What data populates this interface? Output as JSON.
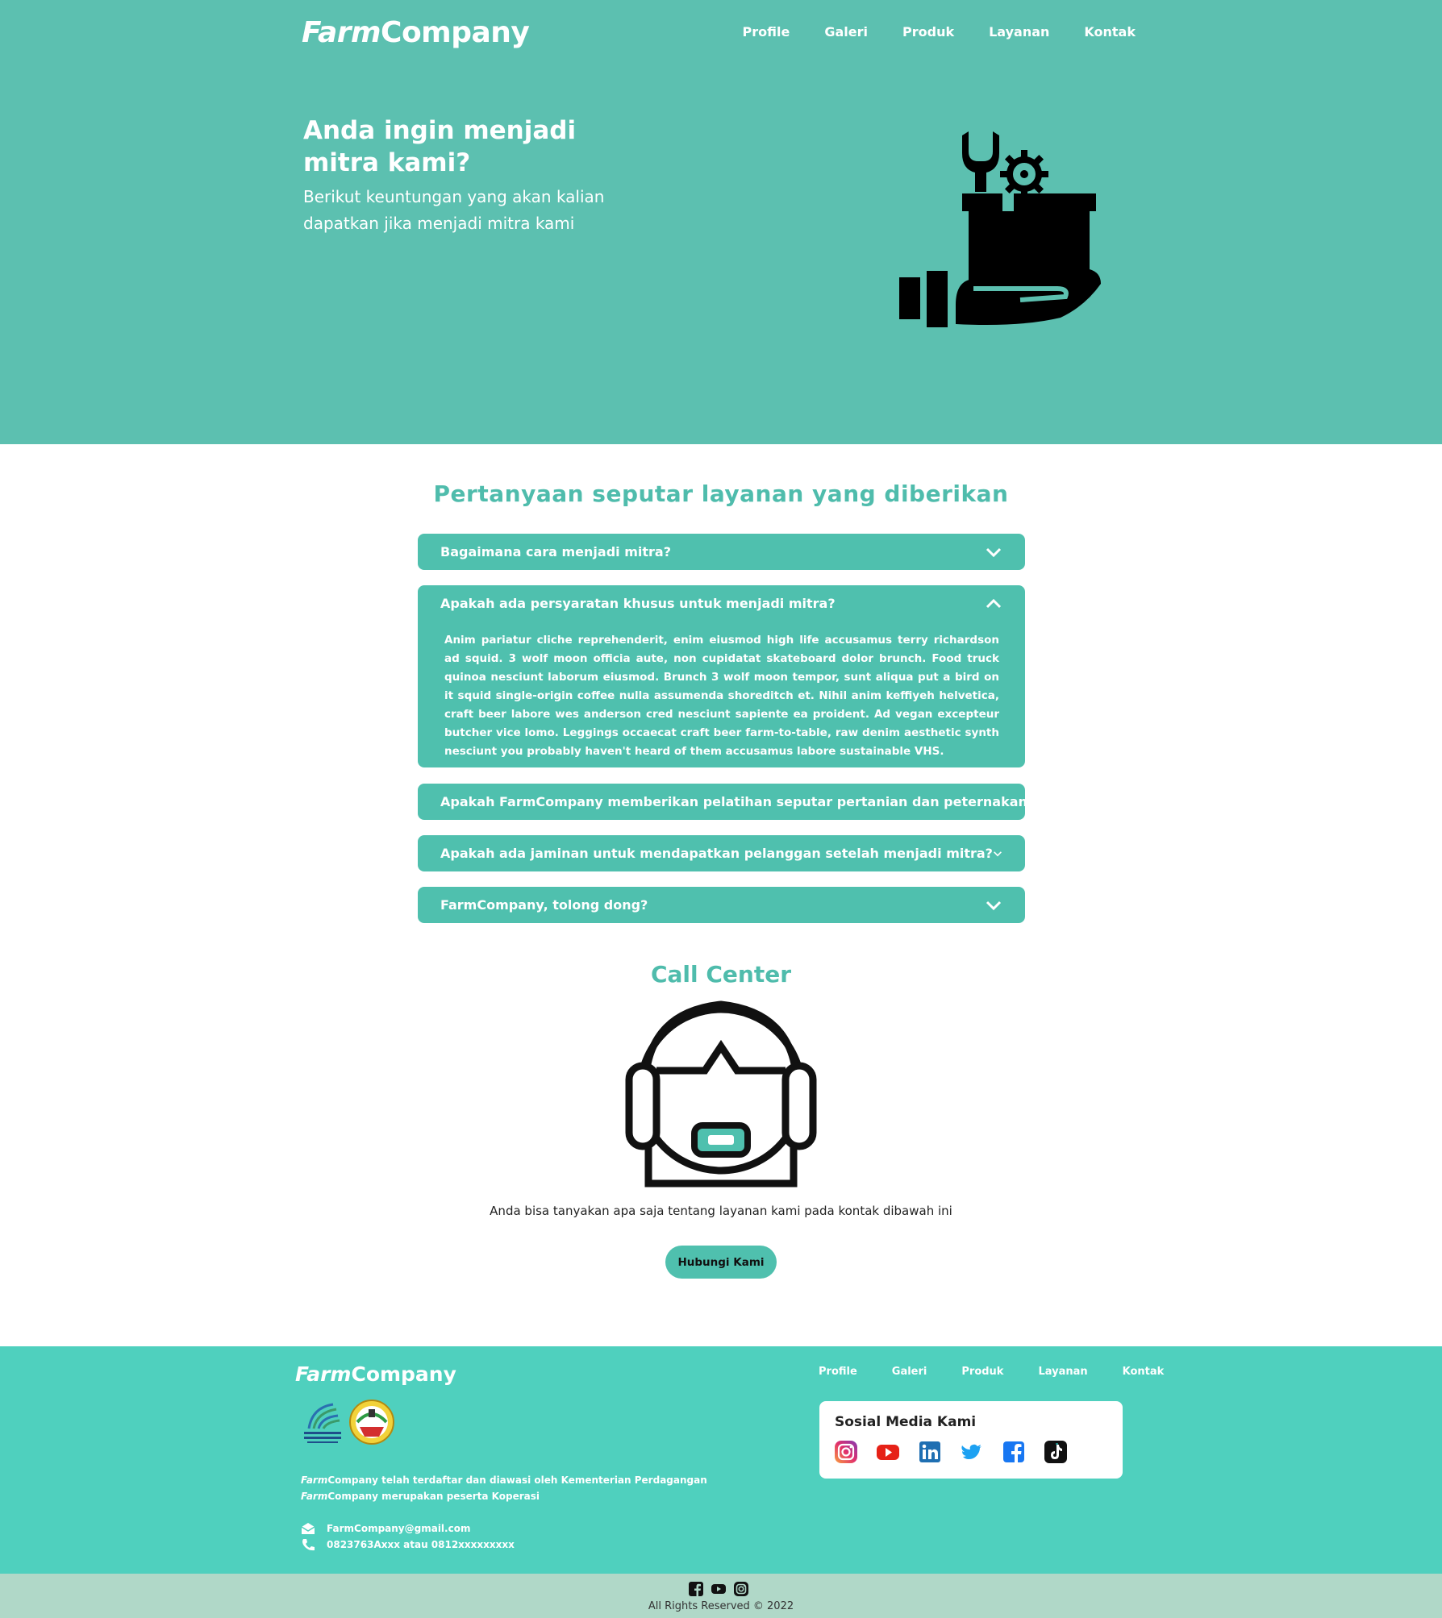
{
  "header": {
    "logo_italic": "Farm",
    "logo_rest": "Company",
    "nav": [
      "Profile",
      "Galeri",
      "Produk",
      "Layanan",
      "Kontak"
    ]
  },
  "hero": {
    "title": "Anda ingin menjadi mitra kami?",
    "subtitle": "Berikut keuntungan yang akan kalian dapatkan jika menjadi mitra kami",
    "icon": "hand-holding-box-tools-icon"
  },
  "faq": {
    "title": "Pertanyaan seputar layanan yang diberikan",
    "items": [
      {
        "question": "Bagaimana cara menjadi mitra?",
        "answer": ""
      },
      {
        "question": "Apakah ada persyaratan khusus untuk menjadi mitra?",
        "answer": "Anim pariatur cliche reprehenderit, enim eiusmod high life accusamus terry richardson ad squid. 3 wolf moon officia aute, non cupidatat skateboard dolor brunch. Food truck quinoa nesciunt laborum eiusmod. Brunch 3 wolf moon tempor, sunt aliqua put a bird on it squid single-origin coffee nulla assumenda shoreditch et. Nihil anim keffiyeh helvetica, craft beer labore wes anderson cred nesciunt sapiente ea proident. Ad vegan excepteur butcher vice lomo. Leggings occaecat craft beer farm-to-table, raw denim aesthetic synth nesciunt you probably haven't heard of them accusamus labore sustainable VHS."
      },
      {
        "question": "Apakah FarmCompany memberikan pelatihan seputar pertanian dan peternakan?",
        "answer": ""
      },
      {
        "question": "Apakah ada jaminan untuk mendapatkan pelanggan setelah menjadi mitra?",
        "answer": ""
      },
      {
        "question": "FarmCompany, tolong dong?",
        "answer": ""
      }
    ]
  },
  "call_center": {
    "title": "Call Center",
    "icon": "headset-support-icon",
    "text": "Anda bisa tanyakan apa saja tentang layanan kami pada kontak dibawah ini",
    "button": "Hubungi Kami"
  },
  "footer": {
    "logo_italic": "Farm",
    "logo_rest": "Company",
    "registered_italic": "Farm",
    "registered_rest": "Company telah terdaftar dan diawasi oleh Kementerian Perdagangan",
    "member_italic": "Farm",
    "member_rest": "Company merupakan peserta Koperasi",
    "email": "FarmCompany@gmail.com",
    "phone": "0823763Axxx atau 0812xxxxxxxxx",
    "nav": [
      "Profile",
      "Galeri",
      "Produk",
      "Layanan",
      "Kontak"
    ],
    "social_title": "Sosial Media Kami",
    "social_icons": [
      "instagram-icon",
      "youtube-icon",
      "linkedin-icon",
      "twitter-icon",
      "facebook-icon",
      "tiktok-icon"
    ],
    "copyright": "All Rights Reserved © 2022"
  },
  "colors": {
    "hero_bg": "#5cc0b0",
    "accent": "#4fc0ae",
    "footer_bg": "#4fd0be",
    "bottom_bg": "#b0d8c8"
  }
}
